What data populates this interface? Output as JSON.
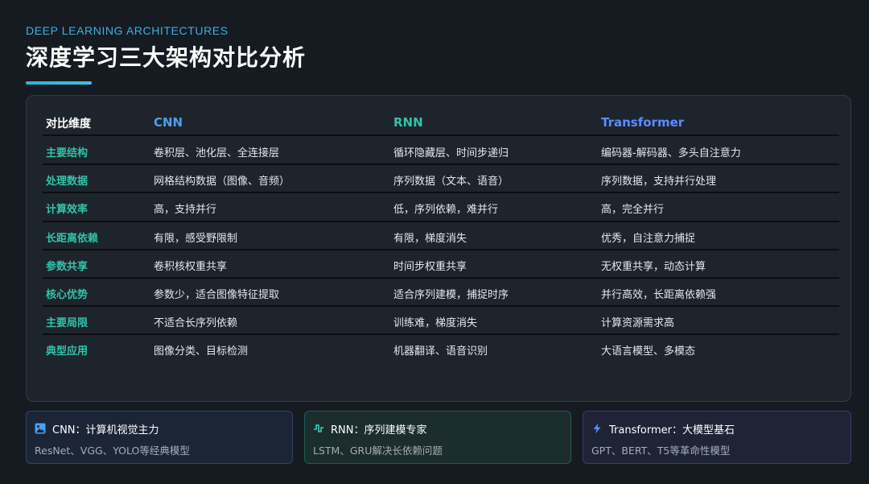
{
  "header": {
    "subtitle": "DEEP LEARNING ARCHITECTURES",
    "title": "深度学习三大架构对比分析"
  },
  "table": {
    "columns": [
      "对比维度",
      "CNN",
      "RNN",
      "Transformer"
    ],
    "rows": [
      [
        "主要结构",
        "卷积层、池化层、全连接层",
        "循环隐藏层、时间步递归",
        "编码器-解码器、多头自注意力"
      ],
      [
        "处理数据",
        "网格结构数据（图像、音频）",
        "序列数据（文本、语音）",
        "序列数据，支持并行处理"
      ],
      [
        "计算效率",
        "高，支持并行",
        "低，序列依赖，难并行",
        "高，完全并行"
      ],
      [
        "长距离依赖",
        "有限，感受野限制",
        "有限，梯度消失",
        "优秀，自注意力捕捉"
      ],
      [
        "参数共享",
        "卷积核权重共享",
        "时间步权重共享",
        "无权重共享，动态计算"
      ],
      [
        "核心优势",
        "参数少，适合图像特征提取",
        "适合序列建模，捕捉时序",
        "并行高效，长距离依赖强"
      ],
      [
        "主要局限",
        "不适合长序列依赖",
        "训练难，梯度消失",
        "计算资源需求高"
      ],
      [
        "典型应用",
        "图像分类、目标检测",
        "机器翻译、语音识别",
        "大语言模型、多模态"
      ]
    ]
  },
  "cards": [
    {
      "icon": "image-icon",
      "title": "CNN：计算机视觉主力",
      "desc": "ResNet、VGG、YOLO等经典模型"
    },
    {
      "icon": "wave-icon",
      "title": "RNN：序列建模专家",
      "desc": "LSTM、GRU解决长依赖问题"
    },
    {
      "icon": "lightning-icon",
      "title": "Transformer：大模型基石",
      "desc": "GPT、BERT、T5等革命性模型"
    }
  ],
  "colors": {
    "accent_cyan": "#36b2e6",
    "cnn": "#4a9ff0",
    "rnn": "#2ec4a9",
    "transformer": "#5a8dff"
  }
}
